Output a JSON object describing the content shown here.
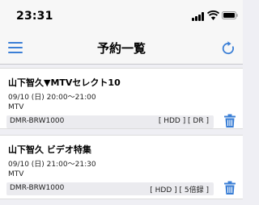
{
  "status_bar": {
    "time": "23:31",
    "battery_level": 1.0
  },
  "nav": {
    "title": "予約一覧",
    "menu_icon": "hamburger-icon",
    "refresh_icon": "refresh-icon",
    "accent_color": "#3b7fd6"
  },
  "reservations": [
    {
      "title": "山下智久▼MTVセレクト10",
      "datetime": "09/10 (日) 20:00～21:00",
      "channel": "MTV",
      "device": "DMR-BRW1000",
      "modes": "[ HDD ] [ DR ]"
    },
    {
      "title": "山下智久 ビデオ特集",
      "datetime": "09/10 (日) 21:00～21:30",
      "channel": "MTV",
      "device": "DMR-BRW1000",
      "modes": "[ HDD ] [ 5倍録 ]"
    }
  ]
}
